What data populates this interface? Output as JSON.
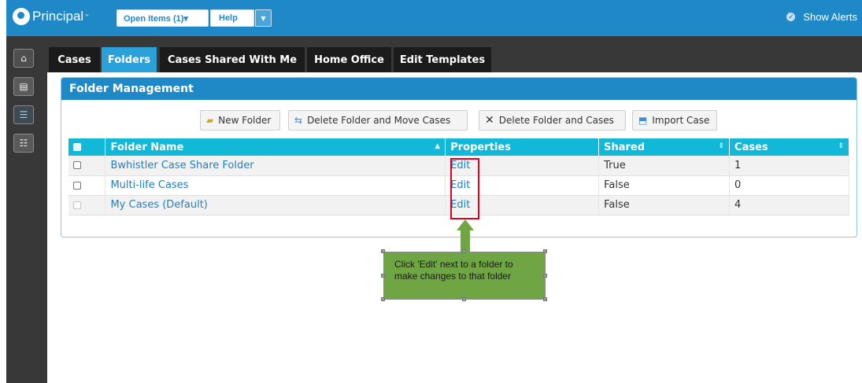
{
  "app": {
    "brand": "Principal",
    "trademark": "™",
    "open_items_label": "Open Items (1)▾",
    "help_label": "Help",
    "show_alerts_label": "Show Alerts"
  },
  "tabs": [
    {
      "label": "Cases",
      "active": false
    },
    {
      "label": "Folders",
      "active": true
    },
    {
      "label": "Cases Shared With Me",
      "active": false
    },
    {
      "label": "Home Office",
      "active": false
    },
    {
      "label": "Edit Templates",
      "active": false
    }
  ],
  "panel": {
    "title": "Folder Management",
    "toolbar": {
      "new_folder": "New Folder",
      "delete_move": "Delete Folder and Move Cases",
      "delete_cases": "Delete Folder and Cases",
      "import_case": "Import Case"
    },
    "columns": {
      "name": "Folder Name",
      "properties": "Properties",
      "shared": "Shared",
      "cases": "Cases"
    },
    "rows": [
      {
        "name": "Bwhistler Case Share Folder",
        "properties": "Edit",
        "shared": "True",
        "cases": "1"
      },
      {
        "name": "Multi-life Cases",
        "properties": "Edit",
        "shared": "False",
        "cases": "0"
      },
      {
        "name": "My Cases (Default)",
        "properties": "Edit",
        "shared": "False",
        "cases": "4"
      }
    ]
  },
  "annotation": {
    "text": "Click 'Edit' next to a folder to make changes to that folder"
  },
  "colors": {
    "brand_blue": "#1f89c7",
    "header_cyan": "#12b8d7",
    "highlight_red": "#e0001b",
    "callout_green": "#6fa542"
  }
}
